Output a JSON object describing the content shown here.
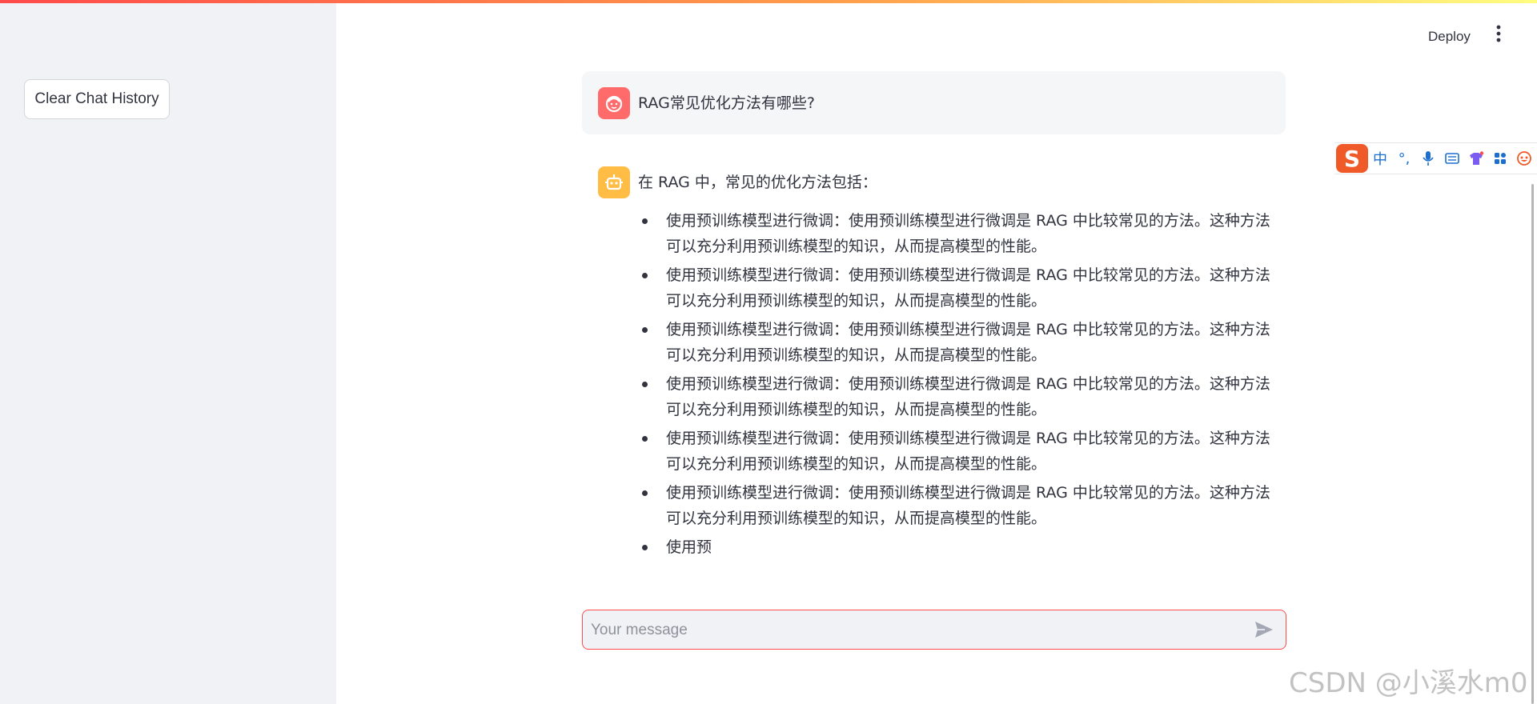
{
  "sidebar": {
    "clear_button": "Clear Chat History"
  },
  "header": {
    "deploy_label": "Deploy",
    "menu_icon": "vertical-ellipsis-icon"
  },
  "user_message": {
    "text": "RAG常见优化方法有哪些?",
    "avatar_color": "#ff6b6b",
    "avatar_icon": "user-face-icon"
  },
  "assistant_message": {
    "avatar_color": "#ffbd45",
    "avatar_icon": "robot-icon",
    "intro": "在 RAG 中，常见的优化方法包括：",
    "items": [
      "使用预训练模型进行微调：使用预训练模型进行微调是 RAG 中比较常见的方法。这种方法可以充分利用预训练模型的知识，从而提高模型的性能。",
      "使用预训练模型进行微调：使用预训练模型进行微调是 RAG 中比较常见的方法。这种方法可以充分利用预训练模型的知识，从而提高模型的性能。",
      "使用预训练模型进行微调：使用预训练模型进行微调是 RAG 中比较常见的方法。这种方法可以充分利用预训练模型的知识，从而提高模型的性能。",
      "使用预训练模型进行微调：使用预训练模型进行微调是 RAG 中比较常见的方法。这种方法可以充分利用预训练模型的知识，从而提高模型的性能。",
      "使用预训练模型进行微调：使用预训练模型进行微调是 RAG 中比较常见的方法。这种方法可以充分利用预训练模型的知识，从而提高模型的性能。",
      "使用预训练模型进行微调：使用预训练模型进行微调是 RAG 中比较常见的方法。这种方法可以充分利用预训练模型的知识，从而提高模型的性能。",
      "使用预"
    ]
  },
  "chat_input": {
    "placeholder": "Your message",
    "value": "",
    "send_icon": "send-icon"
  },
  "ime_toolbar": {
    "logo": "S",
    "mode": "中",
    "punct": "°,",
    "icons": [
      "microphone-icon",
      "keyboard-icon",
      "skin-icon",
      "apps-icon",
      "emoji-icon"
    ]
  },
  "watermark": "CSDN @小溪水m0"
}
